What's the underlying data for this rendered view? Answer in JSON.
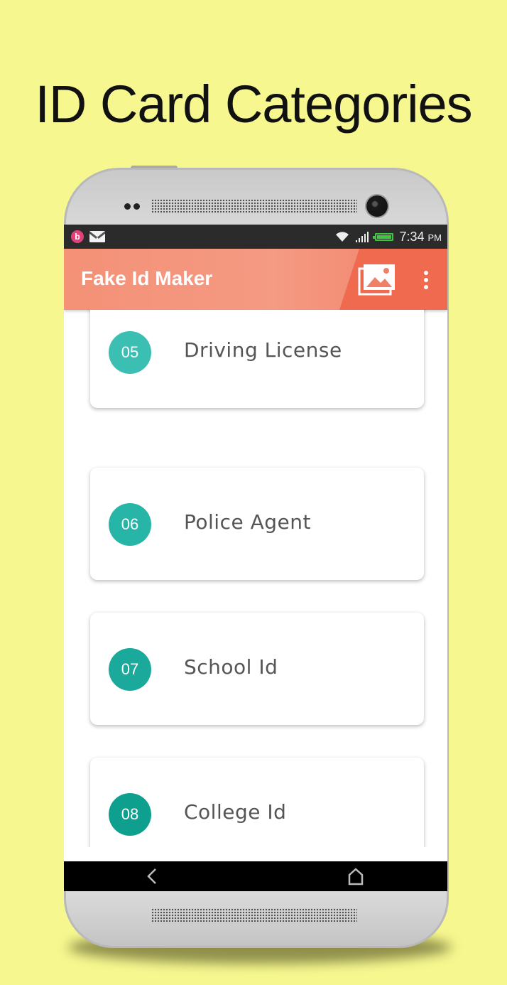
{
  "headline": "ID Card Categories",
  "status_bar": {
    "time": "7:34",
    "ampm": "PM",
    "battery_color": "#3ec63e"
  },
  "app_bar": {
    "title": "Fake Id Maker",
    "gallery_icon": "gallery-icon",
    "menu_icon": "more-vert-icon"
  },
  "categories": [
    {
      "number": "05",
      "label": "Driving License",
      "color": "#3bbfb2"
    },
    {
      "number": "06",
      "label": "Police Agent",
      "color": "#26b5a6"
    },
    {
      "number": "07",
      "label": "School Id",
      "color": "#1aa99a"
    },
    {
      "number": "08",
      "label": "College Id",
      "color": "#0f9f8f"
    }
  ],
  "nav_bar": {
    "back_icon": "back-icon",
    "home_icon": "home-icon"
  }
}
